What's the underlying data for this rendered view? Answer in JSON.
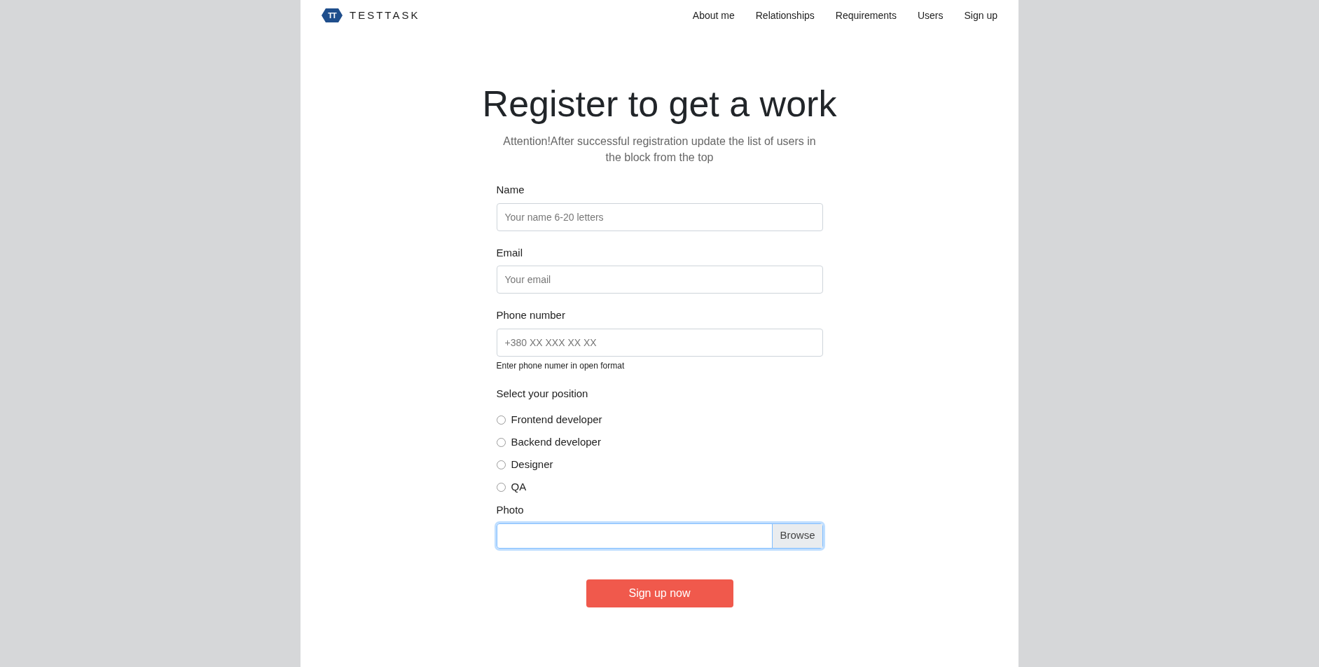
{
  "header": {
    "logo": {
      "mark": "TT",
      "text": "TESTTASK"
    },
    "nav": [
      {
        "label": "About me"
      },
      {
        "label": "Relationships"
      },
      {
        "label": "Requirements"
      },
      {
        "label": "Users"
      },
      {
        "label": "Sign up"
      }
    ]
  },
  "form": {
    "title": "Register to get a work",
    "subtitle": "Attention!After successful registration update the list of users in the block from the top",
    "fields": [
      {
        "label": "Name",
        "placeholder": "Your name 6-20 letters"
      },
      {
        "label": "Email",
        "placeholder": "Your email"
      },
      {
        "label": "Phone number",
        "placeholder": "+380 XX XXX XX XX",
        "hint": "Enter phone numer in open format"
      }
    ],
    "position": {
      "label": "Select your position",
      "options": [
        {
          "label": "Frontend developer",
          "selected": false
        },
        {
          "label": "Backend developer",
          "selected": false
        },
        {
          "label": "Designer",
          "selected": false
        },
        {
          "label": "QA",
          "selected": false
        }
      ]
    },
    "photo": {
      "label": "Photo",
      "button": "Browse",
      "focused": true
    },
    "submit": "Sign up now"
  }
}
